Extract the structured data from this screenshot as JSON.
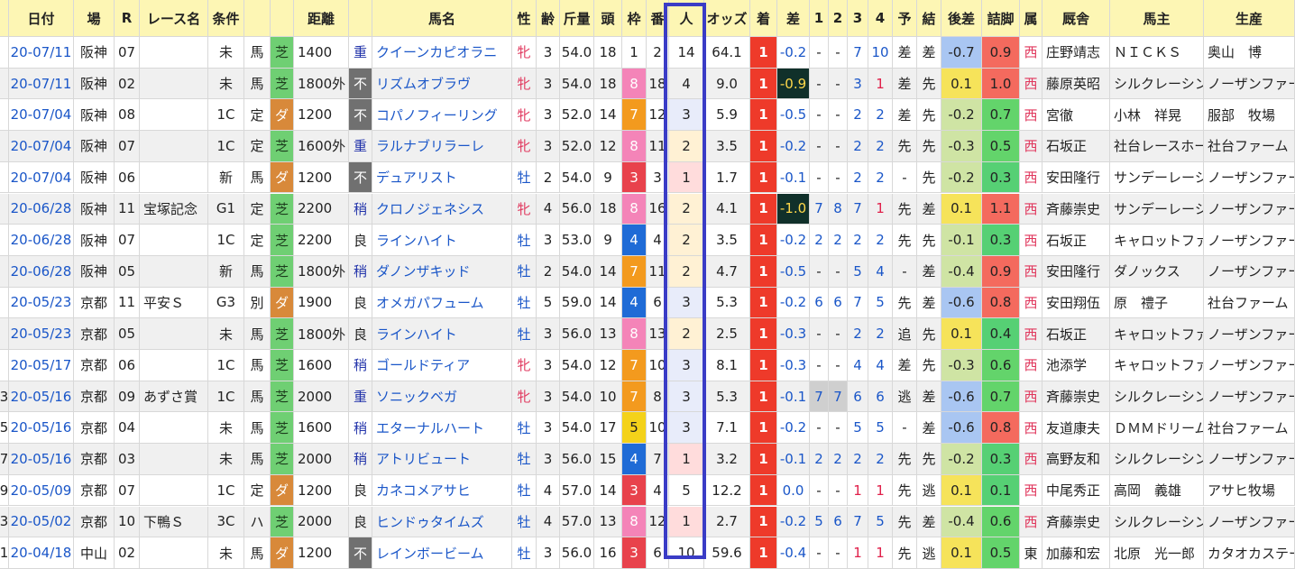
{
  "columns": [
    {
      "key": "no",
      "label": ""
    },
    {
      "key": "date",
      "label": "日付"
    },
    {
      "key": "place",
      "label": "場"
    },
    {
      "key": "r",
      "label": "R"
    },
    {
      "key": "race",
      "label": "レース名"
    },
    {
      "key": "cond",
      "label": "条件"
    },
    {
      "key": "cond2",
      "label": ""
    },
    {
      "key": "surface",
      "label": ""
    },
    {
      "key": "dist",
      "label": "距離"
    },
    {
      "key": "going",
      "label": ""
    },
    {
      "key": "horse",
      "label": "馬名"
    },
    {
      "key": "sex",
      "label": "性"
    },
    {
      "key": "age",
      "label": "齢"
    },
    {
      "key": "weight",
      "label": "斤量"
    },
    {
      "key": "heads",
      "label": "頭"
    },
    {
      "key": "waku",
      "label": "枠"
    },
    {
      "key": "ban",
      "label": "番"
    },
    {
      "key": "pop",
      "label": "人"
    },
    {
      "key": "odds",
      "label": "オッズ"
    },
    {
      "key": "rank",
      "label": "着"
    },
    {
      "key": "diff",
      "label": "差"
    },
    {
      "key": "c1",
      "label": "1"
    },
    {
      "key": "c2",
      "label": "2"
    },
    {
      "key": "c3",
      "label": "3"
    },
    {
      "key": "c4",
      "label": "4"
    },
    {
      "key": "yoso",
      "label": "予"
    },
    {
      "key": "kekka",
      "label": "結"
    },
    {
      "key": "atosa",
      "label": "後差"
    },
    {
      "key": "tsume",
      "label": "詰脚"
    },
    {
      "key": "zoku",
      "label": "属"
    },
    {
      "key": "kyusha",
      "label": "厩舎"
    },
    {
      "key": "owner",
      "label": "馬主"
    },
    {
      "key": "breeder",
      "label": "生産"
    }
  ],
  "rows": [
    {
      "no": "",
      "date": "20-07/11",
      "place": "阪神",
      "r": "07",
      "race": "",
      "cond": "未",
      "cond2": "馬",
      "surface": "芝",
      "dist": "1400",
      "going": "重",
      "horse": "クイーンカピオラニ",
      "sex": "牝",
      "age": "3",
      "weight": "54.0",
      "heads": "18",
      "waku": "1",
      "ban": "2",
      "pop": "14",
      "odds": "64.1",
      "rank": "1",
      "diff": "-0.2",
      "c1": "-",
      "c2": "-",
      "c3": "7",
      "c4": "10",
      "yoso": "差",
      "kekka": "差",
      "atosa": "-0.7",
      "tsume": "0.9",
      "zoku": "西",
      "kyusha": "庄野靖志",
      "owner": "ＮＩＣＫＳ",
      "breeder": "奥山　博"
    },
    {
      "no": "",
      "date": "20-07/11",
      "place": "阪神",
      "r": "02",
      "race": "",
      "cond": "未",
      "cond2": "馬",
      "surface": "芝",
      "dist": "1800外",
      "going": "不",
      "horse": "リズムオブラヴ",
      "sex": "牝",
      "age": "3",
      "weight": "54.0",
      "heads": "18",
      "waku": "8",
      "ban": "18",
      "pop": "4",
      "odds": "9.0",
      "rank": "1",
      "diff": "-0.9",
      "c1": "-",
      "c2": "-",
      "c3": "3",
      "c4": "1",
      "yoso": "差",
      "kekka": "先",
      "atosa": "0.1",
      "tsume": "1.0",
      "zoku": "西",
      "kyusha": "藤原英昭",
      "owner": "シルクレーシング",
      "breeder": "ノーザンファーム"
    },
    {
      "no": "",
      "date": "20-07/04",
      "place": "阪神",
      "r": "08",
      "race": "",
      "cond": "1C",
      "cond2": "定",
      "surface": "ダ",
      "dist": "1200",
      "going": "不",
      "horse": "コパノフィーリング",
      "sex": "牝",
      "age": "3",
      "weight": "52.0",
      "heads": "14",
      "waku": "7",
      "ban": "12",
      "pop": "3",
      "odds": "5.9",
      "rank": "1",
      "diff": "-0.5",
      "c1": "-",
      "c2": "-",
      "c3": "2",
      "c4": "2",
      "yoso": "差",
      "kekka": "先",
      "atosa": "-0.2",
      "tsume": "0.7",
      "zoku": "西",
      "kyusha": "宮徹",
      "owner": "小林　祥晃",
      "breeder": "服部　牧場"
    },
    {
      "no": "",
      "date": "20-07/04",
      "place": "阪神",
      "r": "07",
      "race": "",
      "cond": "1C",
      "cond2": "定",
      "surface": "芝",
      "dist": "1600外",
      "going": "重",
      "horse": "ラルナブリラーレ",
      "sex": "牝",
      "age": "3",
      "weight": "52.0",
      "heads": "12",
      "waku": "8",
      "ban": "11",
      "pop": "2",
      "odds": "3.5",
      "rank": "1",
      "diff": "-0.2",
      "c1": "-",
      "c2": "-",
      "c3": "2",
      "c4": "2",
      "yoso": "先",
      "kekka": "先",
      "atosa": "-0.3",
      "tsume": "0.5",
      "zoku": "西",
      "kyusha": "石坂正",
      "owner": "社台レースホース",
      "breeder": "社台ファーム"
    },
    {
      "no": "",
      "date": "20-07/04",
      "place": "阪神",
      "r": "06",
      "race": "",
      "cond": "新",
      "cond2": "馬",
      "surface": "ダ",
      "dist": "1200",
      "going": "不",
      "horse": "デュアリスト",
      "sex": "牡",
      "age": "2",
      "weight": "54.0",
      "heads": "9",
      "waku": "3",
      "ban": "3",
      "pop": "1",
      "odds": "1.7",
      "rank": "1",
      "diff": "-0.1",
      "c1": "-",
      "c2": "-",
      "c3": "2",
      "c4": "2",
      "yoso": "-",
      "kekka": "先",
      "atosa": "-0.2",
      "tsume": "0.3",
      "zoku": "西",
      "kyusha": "安田隆行",
      "owner": "サンデーレーシング",
      "breeder": "ノーザンファーム"
    },
    {
      "no": "",
      "date": "20-06/28",
      "place": "阪神",
      "r": "11",
      "race": "宝塚記念",
      "cond": "G1",
      "cond2": "定",
      "surface": "芝",
      "dist": "2200",
      "going": "稍",
      "horse": "クロノジェネシス",
      "sex": "牝",
      "age": "4",
      "weight": "56.0",
      "heads": "18",
      "waku": "8",
      "ban": "16",
      "pop": "2",
      "odds": "4.1",
      "rank": "1",
      "diff": "-1.0",
      "c1": "7",
      "c2": "8",
      "c3": "7",
      "c4": "1",
      "yoso": "先",
      "kekka": "差",
      "atosa": "0.1",
      "tsume": "1.1",
      "zoku": "西",
      "kyusha": "斉藤崇史",
      "owner": "サンデーレーシング",
      "breeder": "ノーザンファーム"
    },
    {
      "no": "",
      "date": "20-06/28",
      "place": "阪神",
      "r": "07",
      "race": "",
      "cond": "1C",
      "cond2": "定",
      "surface": "芝",
      "dist": "2200",
      "going": "良",
      "horse": "ラインハイト",
      "sex": "牡",
      "age": "3",
      "weight": "53.0",
      "heads": "9",
      "waku": "4",
      "ban": "4",
      "pop": "2",
      "odds": "3.5",
      "rank": "1",
      "diff": "-0.2",
      "c1": "2",
      "c2": "2",
      "c3": "2",
      "c4": "2",
      "yoso": "先",
      "kekka": "先",
      "atosa": "-0.1",
      "tsume": "0.3",
      "zoku": "西",
      "kyusha": "石坂正",
      "owner": "キャロットファーム",
      "breeder": "ノーザンファーム"
    },
    {
      "no": "",
      "date": "20-06/28",
      "place": "阪神",
      "r": "05",
      "race": "",
      "cond": "新",
      "cond2": "馬",
      "surface": "芝",
      "dist": "1800外",
      "going": "稍",
      "horse": "ダノンザキッド",
      "sex": "牡",
      "age": "2",
      "weight": "54.0",
      "heads": "14",
      "waku": "7",
      "ban": "11",
      "pop": "2",
      "odds": "4.7",
      "rank": "1",
      "diff": "-0.5",
      "c1": "-",
      "c2": "-",
      "c3": "5",
      "c4": "4",
      "yoso": "-",
      "kekka": "差",
      "atosa": "-0.4",
      "tsume": "0.9",
      "zoku": "西",
      "kyusha": "安田隆行",
      "owner": "ダノックス",
      "breeder": "ノーザンファーム"
    },
    {
      "no": "",
      "date": "20-05/23",
      "place": "京都",
      "r": "11",
      "race": "平安Ｓ",
      "cond": "G3",
      "cond2": "別",
      "surface": "ダ",
      "dist": "1900",
      "going": "良",
      "horse": "オメガパフューム",
      "sex": "牡",
      "age": "5",
      "weight": "59.0",
      "heads": "14",
      "waku": "4",
      "ban": "6",
      "pop": "3",
      "odds": "5.3",
      "rank": "1",
      "diff": "-0.2",
      "c1": "6",
      "c2": "6",
      "c3": "7",
      "c4": "5",
      "yoso": "先",
      "kekka": "差",
      "atosa": "-0.6",
      "tsume": "0.8",
      "zoku": "西",
      "kyusha": "安田翔伍",
      "owner": "原　禮子",
      "breeder": "社台ファーム"
    },
    {
      "no": "",
      "date": "20-05/23",
      "place": "京都",
      "r": "05",
      "race": "",
      "cond": "未",
      "cond2": "馬",
      "surface": "芝",
      "dist": "1800外",
      "going": "良",
      "horse": "ラインハイト",
      "sex": "牡",
      "age": "3",
      "weight": "56.0",
      "heads": "13",
      "waku": "8",
      "ban": "13",
      "pop": "2",
      "odds": "2.5",
      "rank": "1",
      "diff": "-0.3",
      "c1": "-",
      "c2": "-",
      "c3": "2",
      "c4": "2",
      "yoso": "追",
      "kekka": "先",
      "atosa": "0.1",
      "tsume": "0.4",
      "zoku": "西",
      "kyusha": "石坂正",
      "owner": "キャロットファーム",
      "breeder": "ノーザンファーム"
    },
    {
      "no": "",
      "date": "20-05/17",
      "place": "京都",
      "r": "06",
      "race": "",
      "cond": "1C",
      "cond2": "馬",
      "surface": "芝",
      "dist": "1600",
      "going": "稍",
      "horse": "ゴールドティア",
      "sex": "牝",
      "age": "3",
      "weight": "54.0",
      "heads": "12",
      "waku": "7",
      "ban": "10",
      "pop": "3",
      "odds": "8.1",
      "rank": "1",
      "diff": "-0.3",
      "c1": "-",
      "c2": "-",
      "c3": "4",
      "c4": "4",
      "yoso": "差",
      "kekka": "先",
      "atosa": "-0.3",
      "tsume": "0.6",
      "zoku": "西",
      "kyusha": "池添学",
      "owner": "キャロットファーム",
      "breeder": "ノーザンファーム"
    },
    {
      "no": "3",
      "date": "20-05/16",
      "place": "京都",
      "r": "09",
      "race": "あずさ賞",
      "cond": "1C",
      "cond2": "馬",
      "surface": "芝",
      "dist": "2000",
      "going": "重",
      "horse": "ソニックベガ",
      "sex": "牝",
      "age": "3",
      "weight": "54.0",
      "heads": "10",
      "waku": "7",
      "ban": "8",
      "pop": "3",
      "odds": "5.3",
      "rank": "1",
      "diff": "-0.1",
      "c1": "7",
      "c2": "7",
      "c3": "6",
      "c4": "6",
      "yoso": "逃",
      "kekka": "差",
      "atosa": "-0.6",
      "tsume": "0.7",
      "zoku": "西",
      "kyusha": "斉藤崇史",
      "owner": "シルクレーシング",
      "breeder": "ノーザンファーム"
    },
    {
      "no": "5",
      "date": "20-05/16",
      "place": "京都",
      "r": "04",
      "race": "",
      "cond": "未",
      "cond2": "馬",
      "surface": "芝",
      "dist": "1600",
      "going": "稍",
      "horse": "エターナルハート",
      "sex": "牡",
      "age": "3",
      "weight": "54.0",
      "heads": "17",
      "waku": "5",
      "ban": "10",
      "pop": "3",
      "odds": "7.1",
      "rank": "1",
      "diff": "-0.2",
      "c1": "-",
      "c2": "-",
      "c3": "5",
      "c4": "5",
      "yoso": "-",
      "kekka": "差",
      "atosa": "-0.6",
      "tsume": "0.8",
      "zoku": "西",
      "kyusha": "友道康夫",
      "owner": "ＤＭＭドリームクラブ",
      "breeder": "社台ファーム"
    },
    {
      "no": "7",
      "date": "20-05/16",
      "place": "京都",
      "r": "03",
      "race": "",
      "cond": "未",
      "cond2": "馬",
      "surface": "芝",
      "dist": "2000",
      "going": "稍",
      "horse": "アトリビュート",
      "sex": "牡",
      "age": "3",
      "weight": "56.0",
      "heads": "15",
      "waku": "4",
      "ban": "7",
      "pop": "1",
      "odds": "3.2",
      "rank": "1",
      "diff": "-0.1",
      "c1": "2",
      "c2": "2",
      "c3": "2",
      "c4": "2",
      "yoso": "先",
      "kekka": "先",
      "atosa": "-0.2",
      "tsume": "0.3",
      "zoku": "西",
      "kyusha": "高野友和",
      "owner": "シルクレーシング",
      "breeder": "ノーザンファーム"
    },
    {
      "no": "9",
      "date": "20-05/09",
      "place": "京都",
      "r": "07",
      "race": "",
      "cond": "1C",
      "cond2": "定",
      "surface": "ダ",
      "dist": "1200",
      "going": "良",
      "horse": "カネコメアサヒ",
      "sex": "牡",
      "age": "4",
      "weight": "57.0",
      "heads": "14",
      "waku": "3",
      "ban": "4",
      "pop": "5",
      "odds": "12.2",
      "rank": "1",
      "diff": "0.0",
      "c1": "-",
      "c2": "-",
      "c3": "1",
      "c4": "1",
      "yoso": "先",
      "kekka": "逃",
      "atosa": "0.1",
      "tsume": "0.1",
      "zoku": "西",
      "kyusha": "中尾秀正",
      "owner": "高岡　義雄",
      "breeder": "アサヒ牧場"
    },
    {
      "no": "3",
      "date": "20-05/02",
      "place": "京都",
      "r": "10",
      "race": "下鴨Ｓ",
      "cond": "3C",
      "cond2": "ハ",
      "surface": "芝",
      "dist": "2000",
      "going": "良",
      "horse": "ヒンドゥタイムズ",
      "sex": "牡",
      "age": "4",
      "weight": "57.0",
      "heads": "13",
      "waku": "8",
      "ban": "12",
      "pop": "1",
      "odds": "2.7",
      "rank": "1",
      "diff": "-0.2",
      "c1": "5",
      "c2": "6",
      "c3": "7",
      "c4": "5",
      "yoso": "先",
      "kekka": "差",
      "atosa": "-0.4",
      "tsume": "0.6",
      "zoku": "西",
      "kyusha": "斉藤崇史",
      "owner": "シルクレーシング",
      "breeder": "ノーザンファーム"
    },
    {
      "no": "1",
      "date": "20-04/18",
      "place": "中山",
      "r": "02",
      "race": "",
      "cond": "未",
      "cond2": "馬",
      "surface": "ダ",
      "dist": "1200",
      "going": "不",
      "horse": "レインボービーム",
      "sex": "牡",
      "age": "3",
      "weight": "56.0",
      "heads": "16",
      "waku": "3",
      "ban": "6",
      "pop": "10",
      "odds": "59.6",
      "rank": "1",
      "diff": "-0.4",
      "c1": "-",
      "c2": "-",
      "c3": "1",
      "c4": "1",
      "yoso": "先",
      "kekka": "逃",
      "atosa": "0.1",
      "tsume": "0.5",
      "zoku": "東",
      "kyusha": "加藤和宏",
      "owner": "北原　光一郎",
      "breeder": "カタオカステーブル"
    }
  ],
  "colors": {
    "header_bg": "#fdf6b4",
    "odd_row": "#ffffff",
    "even_row": "#f0f0f0",
    "shiba": "#6fcf73",
    "dirt": "#d8893a",
    "going_fu": "#707070",
    "rank_1": "#ee3a2a",
    "pop_1": "#ffdcdc",
    "pop_2": "#fff1d4",
    "pop_3": "#e8ecfa",
    "diff_big": "#10302a",
    "kyusha_pink": "#f7b8c8",
    "owner_purple": "#a0a2ee",
    "highlight_border": "#3a3cc6"
  }
}
